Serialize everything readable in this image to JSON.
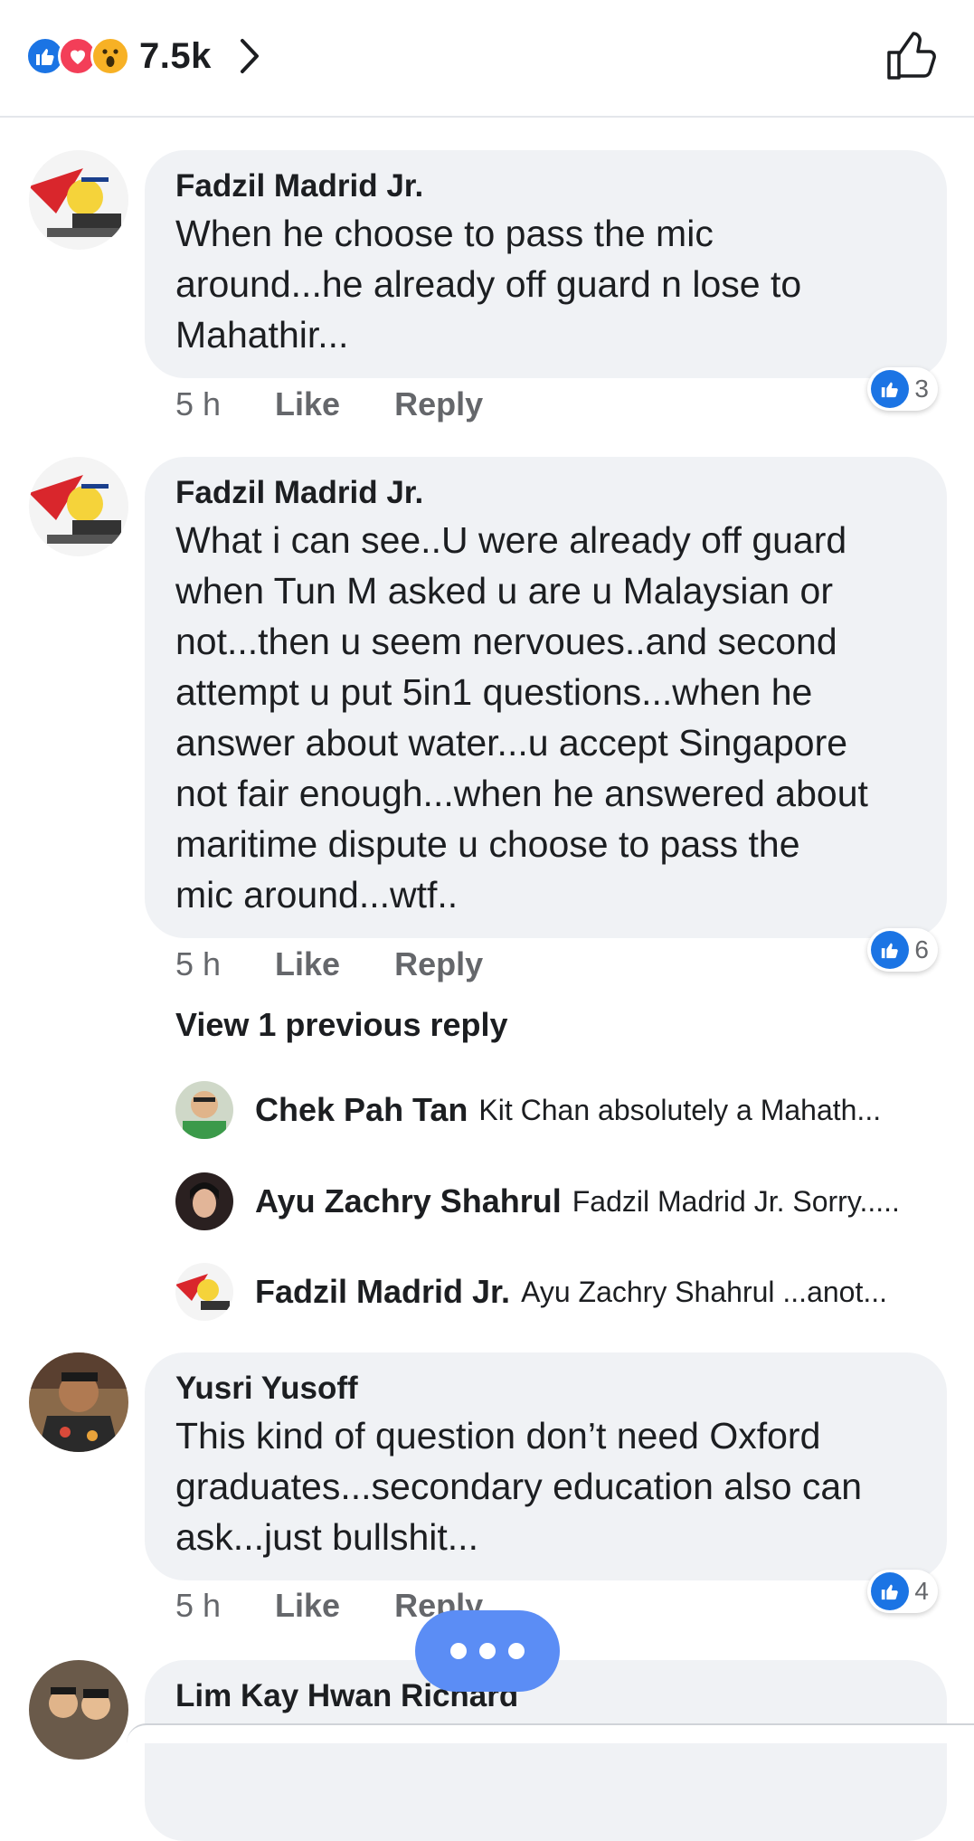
{
  "header": {
    "reaction_count": "7.5k",
    "reaction_icons": [
      "like-icon",
      "love-icon",
      "wow-icon"
    ]
  },
  "comments": [
    {
      "author": "Fadzil Madrid Jr.",
      "lines": [
        "When he choose to pass the mic",
        "around...he already off guard n lose to",
        "Mahathir..."
      ],
      "time": "5 h",
      "like_label": "Like",
      "reply_label": "Reply",
      "reactions": "3"
    },
    {
      "author": "Fadzil Madrid Jr.",
      "lines": [
        "What i can see..U were already off guard",
        "when Tun M asked u are u Malaysian or",
        "not...then u seem nervoues..and second",
        "attempt u put 5in1 questions...when he",
        "answer about water...u accept Singapore",
        "not fair enough...when he answered about",
        "maritime dispute u choose to pass the",
        "mic around...wtf.."
      ],
      "time": "5 h",
      "like_label": "Like",
      "reply_label": "Reply",
      "reactions": "6"
    },
    {
      "author": "Yusri Yusoff",
      "lines": [
        "This kind of question don’t need Oxford",
        "graduates...secondary education also can",
        "ask...just bullshit..."
      ],
      "time": "5 h",
      "like_label": "Like",
      "reply_label": "Reply",
      "reactions": "4"
    },
    {
      "author": "Lim Kay Hwan Richard"
    }
  ],
  "view_previous": "View 1 previous reply",
  "replies": [
    {
      "author": "Chek Pah Tan",
      "text": "Kit Chan absolutely a Mahath..."
    },
    {
      "author": "Ayu Zachry Shahrul",
      "text": "Fadzil Madrid Jr. Sorry....."
    },
    {
      "author": "Fadzil Madrid Jr.",
      "text": "Ayu Zachry Shahrul ...anot..."
    }
  ],
  "colors": {
    "accent": "#1b74e4",
    "bubble": "#f0f2f5",
    "meta": "#65676b",
    "fab": "#5b8df5"
  }
}
